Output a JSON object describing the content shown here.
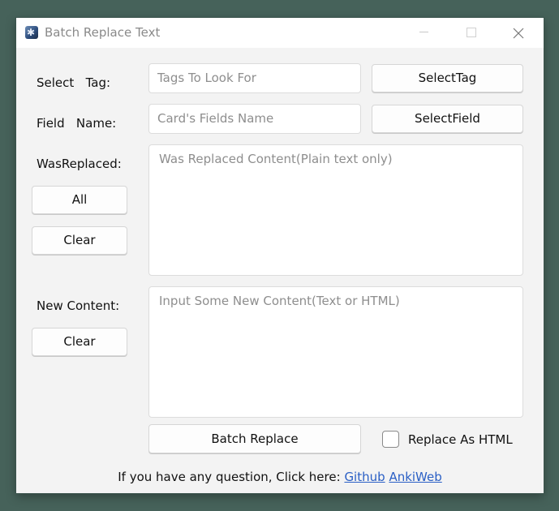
{
  "window": {
    "title": "Batch Replace Text"
  },
  "tag_row": {
    "label": "Select   Tag:",
    "input_placeholder": "Tags To Look For",
    "button": "SelectTag"
  },
  "field_row": {
    "label": "Field   Name:",
    "input_placeholder": "Card's Fields Name",
    "button": "SelectField"
  },
  "replaced": {
    "label": "WasReplaced:",
    "all_button": "All",
    "clear_button": "Clear",
    "placeholder": "Was Replaced Content(Plain text only)"
  },
  "new_content": {
    "label": "New Content:",
    "clear_button": "Clear",
    "placeholder": "Input Some New Content(Text or HTML)"
  },
  "actions": {
    "batch_replace": "Batch Replace",
    "replace_as_html_label": "Replace As HTML",
    "replace_as_html_checked": false
  },
  "footer": {
    "text": "If you have any question, Click here: ",
    "link_github": "Github",
    "link_ankiweb": "AnkiWeb"
  },
  "icons": {
    "app": "app-icon",
    "minimize": "minimize-icon",
    "maximize": "maximize-icon",
    "close": "close-icon"
  }
}
